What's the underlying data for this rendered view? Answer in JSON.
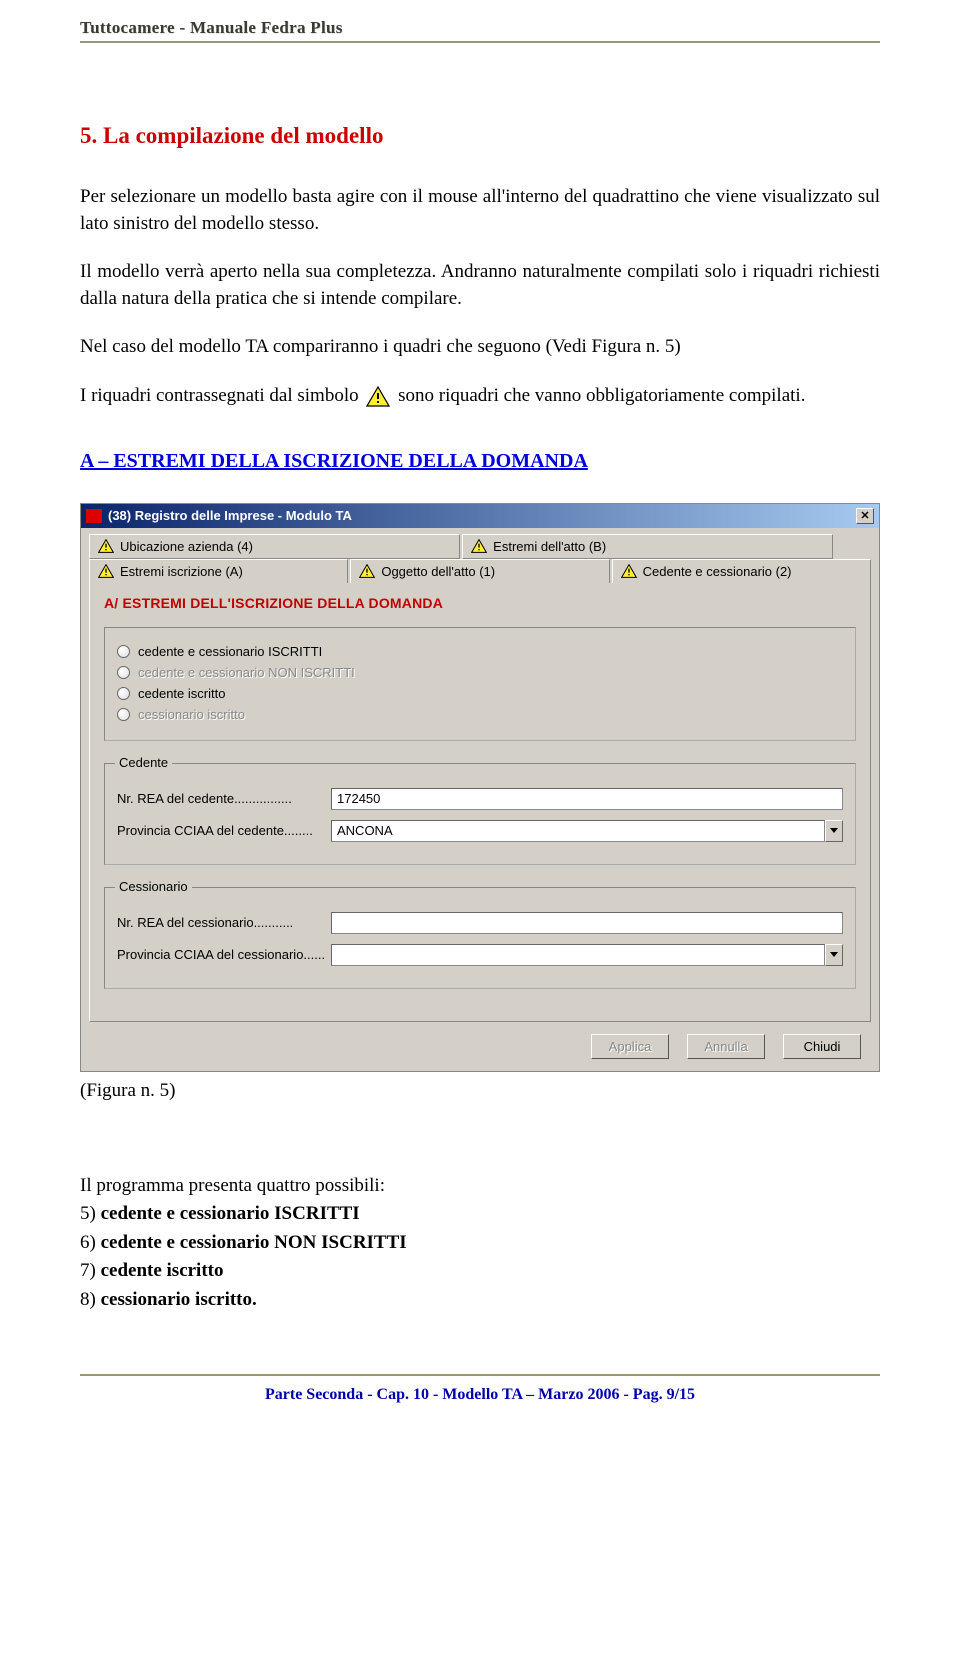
{
  "header": {
    "running_head": "Tuttocamere - Manuale Fedra Plus"
  },
  "section": {
    "title": "5. La compilazione del modello",
    "p1": "Per selezionare un modello basta agire con il mouse all'interno del quadrattino che viene visualizzato sul lato sinistro del modello stesso.",
    "p2": "Il modello verrà aperto nella sua completezza. Andranno naturalmente compilati solo i riquadri richiesti dalla natura della pratica che si intende compilare.",
    "p3": "Nel caso del modello TA compariranno i quadri che seguono (Vedi Figura n. 5)",
    "p4_before": "I riquadri contrassegnati dal simbolo ",
    "p4_after": " sono riquadri che vanno obbligatoriamente compilati.",
    "sub_heading": "A – ESTREMI DELLA ISCRIZIONE DELLA DOMANDA"
  },
  "screenshot": {
    "window_title": "(38) Registro delle Imprese - Modulo TA",
    "tabs_back": [
      "Ubicazione azienda (4)",
      "Estremi dell'atto (B)"
    ],
    "tabs_front": [
      "Estremi iscrizione (A)",
      "Oggetto dell'atto (1)",
      "Cedente e cessionario (2)"
    ],
    "form_heading": "A/ ESTREMI DELL'ISCRIZIONE DELLA DOMANDA",
    "radios": [
      {
        "label": "cedente e cessionario ISCRITTI",
        "enabled": true
      },
      {
        "label": "cedente e cessionario NON ISCRITTI",
        "enabled": false
      },
      {
        "label": "cedente iscritto",
        "enabled": true
      },
      {
        "label": "cessionario iscritto",
        "enabled": false
      }
    ],
    "group_cedente": {
      "legend": "Cedente",
      "rea_label": "Nr. REA del cedente................",
      "rea_value": "172450",
      "prov_label": "Provincia CCIAA del cedente........",
      "prov_value": "ANCONA"
    },
    "group_cessionario": {
      "legend": "Cessionario",
      "rea_label": "Nr. REA del cessionario...........",
      "rea_value": "",
      "prov_label": "Provincia CCIAA del cessionario......",
      "prov_value": ""
    },
    "buttons": {
      "apply": "Applica",
      "cancel": "Annulla",
      "close": "Chiudi"
    }
  },
  "caption": "(Figura n. 5)",
  "list": {
    "intro": "Il programma presenta quattro possibili:",
    "items": [
      {
        "n": "5)",
        "text": "cedente e cessionario ISCRITTI"
      },
      {
        "n": "6)",
        "text": "cedente e cessionario NON ISCRITTI"
      },
      {
        "n": "7)",
        "text": "cedente iscritto"
      },
      {
        "n": "8)",
        "text": "cessionario iscritto."
      }
    ]
  },
  "footer": "Parte Seconda - Cap. 10 - Modello TA – Marzo 2006 - Pag. 9/15"
}
